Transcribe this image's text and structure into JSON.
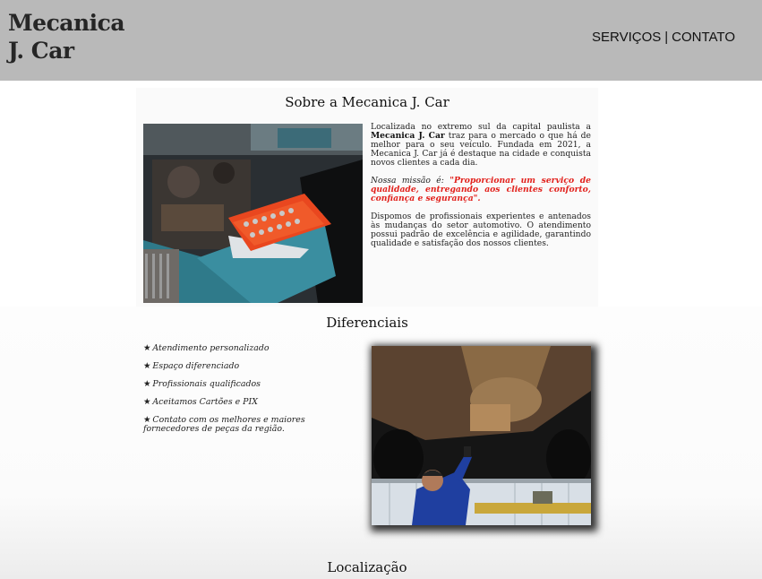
{
  "header": {
    "logo_line1": "Mecanica",
    "logo_line2": "J. Car",
    "nav": {
      "servicos": "SERVIÇOS",
      "separator": "|",
      "contato": "CONTATO"
    }
  },
  "sobre": {
    "title": "Sobre a Mecanica J. Car",
    "p1_before": "Localizada no extremo sul da capital paulista a ",
    "p1_bold": "Mecanica J. Car",
    "p1_after": " traz para o mercado o que há de melhor para o seu veículo. Fundada em 2021, a Mecanica J. Car já é destaque na cidade e conquista novos clientes a cada dia.",
    "missao_label": "Nossa missão é: ",
    "missao_text": "\"Proporcionar um serviço de qualidade, entregando aos clientes conforto, confiança e segurança\".",
    "p3": "Dispomos de profissionais experientes e antenados às mudanças do setor automotivo. O atendimento possui padrão de excelência e agilidade, garantindo qualidade e satisfação dos nossos clientes."
  },
  "diferenciais": {
    "title": "Diferenciais",
    "items": [
      "Atendimento personalizado",
      "Espaço diferenciado",
      "Profissionais qualificados",
      "Aceitamos Cartões e PIX",
      "Contato com os melhores e maiores fornecedores de peças da região."
    ]
  },
  "localizacao": {
    "title": "Localização"
  },
  "colors": {
    "header_bg": "#b9b9b9",
    "missao_red": "#e2211c"
  }
}
